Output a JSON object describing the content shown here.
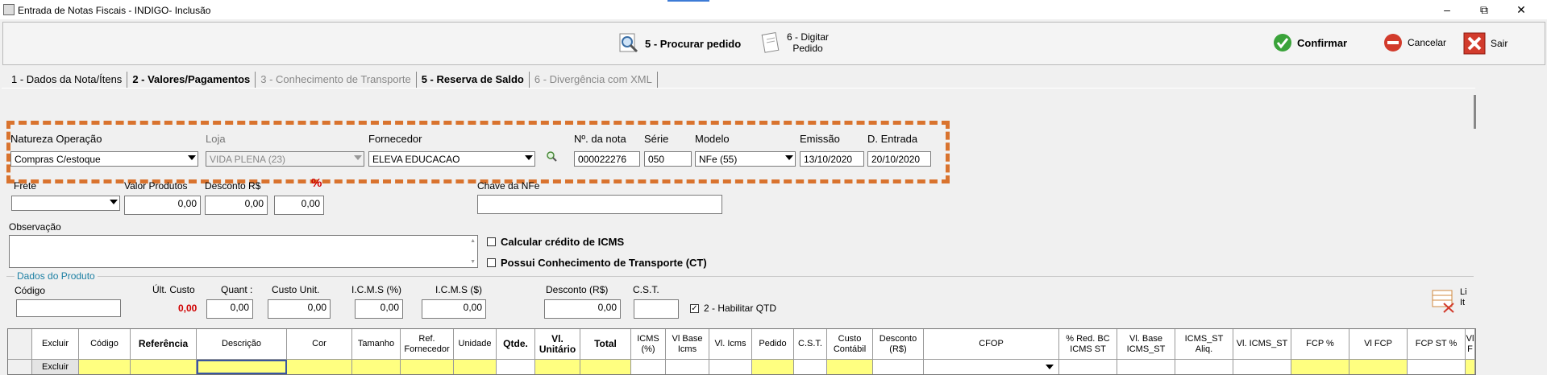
{
  "window": {
    "title": "Entrada de Notas Fiscais - INDIGO- Inclusão"
  },
  "toolbar": {
    "procurar_label": "5 - Procurar pedido",
    "digitar_line1": "6 - Digitar",
    "digitar_line2": "Pedido",
    "confirmar_label": "Confirmar",
    "cancelar_label": "Cancelar",
    "sair_label": "Sair"
  },
  "tabs": [
    {
      "label": "1 - Dados da Nota/Ítens"
    },
    {
      "label": "2 - Valores/Pagamentos"
    },
    {
      "label": "3 - Conhecimento de Transporte"
    },
    {
      "label": "5 - Reserva de Saldo"
    },
    {
      "label": "6 - Divergência com XML"
    }
  ],
  "header": {
    "natureza_label": "Natureza Operação",
    "natureza_value": "Compras C/estoque",
    "loja_label": "Loja",
    "loja_value": "VIDA PLENA (23)",
    "fornecedor_label": "Fornecedor",
    "fornecedor_value": "ELEVA EDUCACAO",
    "nota_label": "Nº. da nota",
    "nota_value": "000022276",
    "serie_label": "Série",
    "serie_value": "050",
    "modelo_label": "Modelo",
    "modelo_value": "NFe (55)",
    "emissao_label": "Emissão",
    "emissao_value": "13/10/2020",
    "entrada_label": "D. Entrada",
    "entrada_value": "20/10/2020"
  },
  "row2": {
    "frete_label": "Frete",
    "valor_produtos_label": "Valor Produtos",
    "valor_produtos_value": "0,00",
    "desconto_label": "Desconto R$",
    "desconto_value": "0,00",
    "percent_label": "%",
    "percent_value": "0,00",
    "chave_label": "Chave da NFe"
  },
  "observacao_label": "Observação",
  "checks": {
    "icms_label": "Calcular crédito de ICMS",
    "ct_label": "Possui Conhecimento de Transporte (CT)"
  },
  "produto": {
    "group_label": "Dados do Produto",
    "codigo_label": "Código",
    "ult_custo_label": "Últ. Custo",
    "ult_custo_value": "0,00",
    "quant_label": "Quant :",
    "quant_value": "0,00",
    "custo_unit_label": "Custo Unit.",
    "custo_unit_value": "0,00",
    "icms_pct_label": "I.C.M.S (%)",
    "icms_pct_value": "0,00",
    "icms_val_label": "I.C.M.S ($)",
    "icms_val_value": "0,00",
    "desconto_label": "Desconto (R$)",
    "desconto_value": "0,00",
    "cst_label": "C.S.T.",
    "habilitar_label": "2 - Habilitar QTD",
    "limpar_line1": "Li",
    "limpar_line2": "It"
  },
  "grid": {
    "columns": [
      "Excluir",
      "Código",
      "Referência",
      "Descrição",
      "Cor",
      "Tamanho",
      "Ref. Fornecedor",
      "Unidade",
      "Qtde.",
      "Vl. Unitário",
      "Total",
      "ICMS (%)",
      "Vl Base Icms",
      "Vl. Icms",
      "Pedido",
      "C.S.T.",
      "Custo Contábil",
      "Desconto (R$)",
      "CFOP",
      "% Red. BC ICMS ST",
      "Vl. Base ICMS_ST",
      "ICMS_ST Aliq.",
      "Vl. ICMS_ST",
      "FCP %",
      "Vl FCP",
      "FCP ST %",
      "Vl F"
    ],
    "row_excluir": "Excluir"
  }
}
